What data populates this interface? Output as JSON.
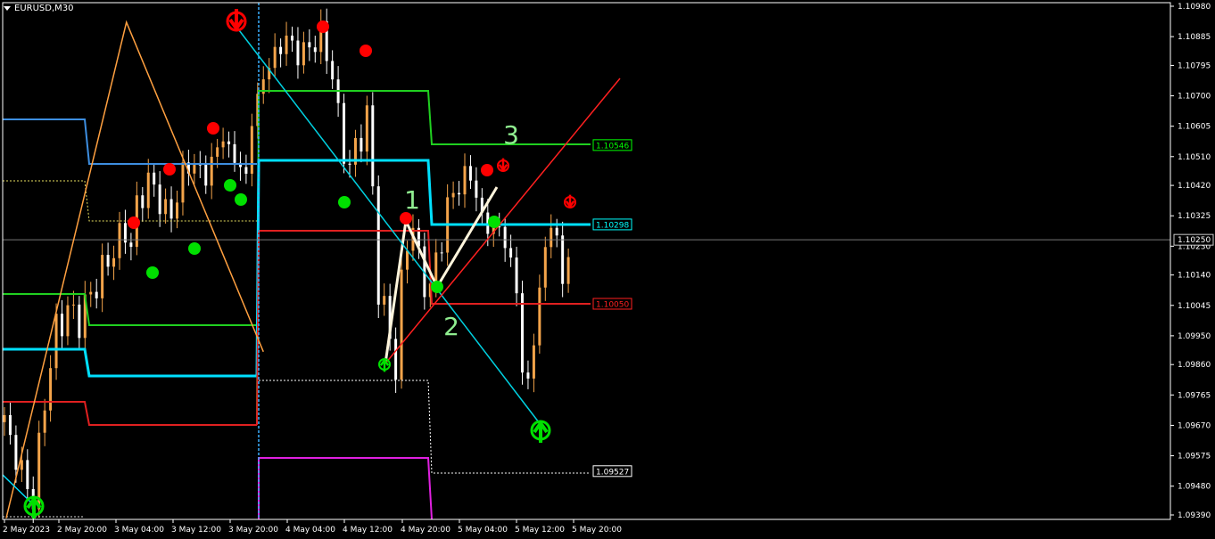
{
  "symbol_label": "EURUSD,M30",
  "colors": {
    "background": "#000000",
    "bull_candle": "#f4a44a",
    "bear_candle": "#ffffff",
    "axis": "#ffffff",
    "fractal_up": "#ff0000",
    "fractal_down": "#00e000",
    "zigzag": "#ffa040",
    "trend_line": "#00d0e0",
    "channel_red": "#ff2020",
    "wave_text": "#90ee90"
  },
  "chart_data": {
    "type": "candlestick",
    "timeframe": "M30",
    "ylim": [
      1.0936,
      1.11
    ],
    "y_ticks": [
      "1.10980",
      "1.10885",
      "1.10795",
      "1.10700",
      "1.10605",
      "1.10510",
      "1.10420",
      "1.10325",
      "1.10230",
      "1.10140",
      "1.10045",
      "1.09950",
      "1.09860",
      "1.09765",
      "1.09670",
      "1.09575",
      "1.09480",
      "1.09390"
    ],
    "x_ticks": [
      "2 May 2023",
      "2 May 20:00",
      "3 May 04:00",
      "3 May 12:00",
      "3 May 20:00",
      "4 May 04:00",
      "4 May 12:00",
      "4 May 20:00",
      "5 May 04:00",
      "5 May 12:00",
      "5 May 20:00"
    ],
    "current_price": "1.10250",
    "level_labels": [
      {
        "text": "1.10546",
        "price": 1.10546,
        "color": "#00ff00"
      },
      {
        "text": "1.10298",
        "price": 1.10298,
        "color": "#00ffff"
      },
      {
        "text": "1.10050",
        "price": 1.1005,
        "color": "#ff2020"
      },
      {
        "text": "1.09527",
        "price": 1.09527,
        "color": "#ffffff"
      }
    ],
    "close_path": [
      [
        0,
        1.0968
      ],
      [
        3,
        1.0952
      ],
      [
        5,
        1.0944
      ],
      [
        7,
        1.0975
      ],
      [
        9,
        1.0997
      ],
      [
        11,
        1.1003
      ],
      [
        13,
        1.1
      ],
      [
        15,
        1.1008
      ],
      [
        17,
        1.1015
      ],
      [
        19,
        1.1022
      ],
      [
        21,
        1.1028
      ],
      [
        22,
        1.1023
      ],
      [
        23,
        1.1035
      ],
      [
        25,
        1.1044
      ],
      [
        27,
        1.1037
      ],
      [
        29,
        1.1032
      ],
      [
        31,
        1.1046
      ],
      [
        33,
        1.1049
      ],
      [
        35,
        1.1044
      ],
      [
        36,
        1.105
      ],
      [
        38,
        1.1057
      ],
      [
        40,
        1.105
      ],
      [
        42,
        1.1045
      ],
      [
        43,
        1.1062
      ],
      [
        45,
        1.1076
      ],
      [
        47,
        1.1083
      ],
      [
        49,
        1.1088
      ],
      [
        51,
        1.1083
      ],
      [
        53,
        1.1085
      ],
      [
        55,
        1.1089
      ],
      [
        57,
        1.1077
      ],
      [
        58,
        1.1063
      ],
      [
        59,
        1.1053
      ],
      [
        60,
        1.1048
      ],
      [
        61,
        1.1053
      ],
      [
        62,
        1.1058
      ],
      [
        63,
        1.1064
      ],
      [
        64,
        1.104
      ],
      [
        65,
        1.101
      ],
      [
        67,
        1.0995
      ],
      [
        68,
        1.0985
      ],
      [
        69,
        1.101
      ],
      [
        70,
        1.1025
      ],
      [
        71,
        1.103
      ],
      [
        72,
        1.1018
      ],
      [
        73,
        1.1012
      ],
      [
        74,
        1.101
      ],
      [
        75,
        1.1018
      ],
      [
        76,
        1.1026
      ],
      [
        77,
        1.1035
      ],
      [
        79,
        1.1043
      ],
      [
        81,
        1.1045
      ],
      [
        82,
        1.104
      ],
      [
        83,
        1.103
      ],
      [
        85,
        1.1029
      ],
      [
        87,
        1.1025
      ],
      [
        88,
        1.1018
      ],
      [
        89,
        1.1008
      ],
      [
        90,
        1.0985
      ],
      [
        91,
        1.098
      ],
      [
        92,
        1.0993
      ],
      [
        93,
        1.101
      ],
      [
        94,
        1.1022
      ],
      [
        95,
        1.103
      ],
      [
        96,
        1.1025
      ],
      [
        97,
        1.1012
      ],
      [
        98,
        1.102
      ]
    ],
    "zigzag": [
      [
        0.3,
        1.0938
      ],
      [
        21.2,
        1.1093
      ],
      [
        45,
        1.099
      ],
      [
        51,
        1.102
      ],
      [
        56,
        1.107
      ],
      [
        70,
        1.0999
      ]
    ]
  }
}
